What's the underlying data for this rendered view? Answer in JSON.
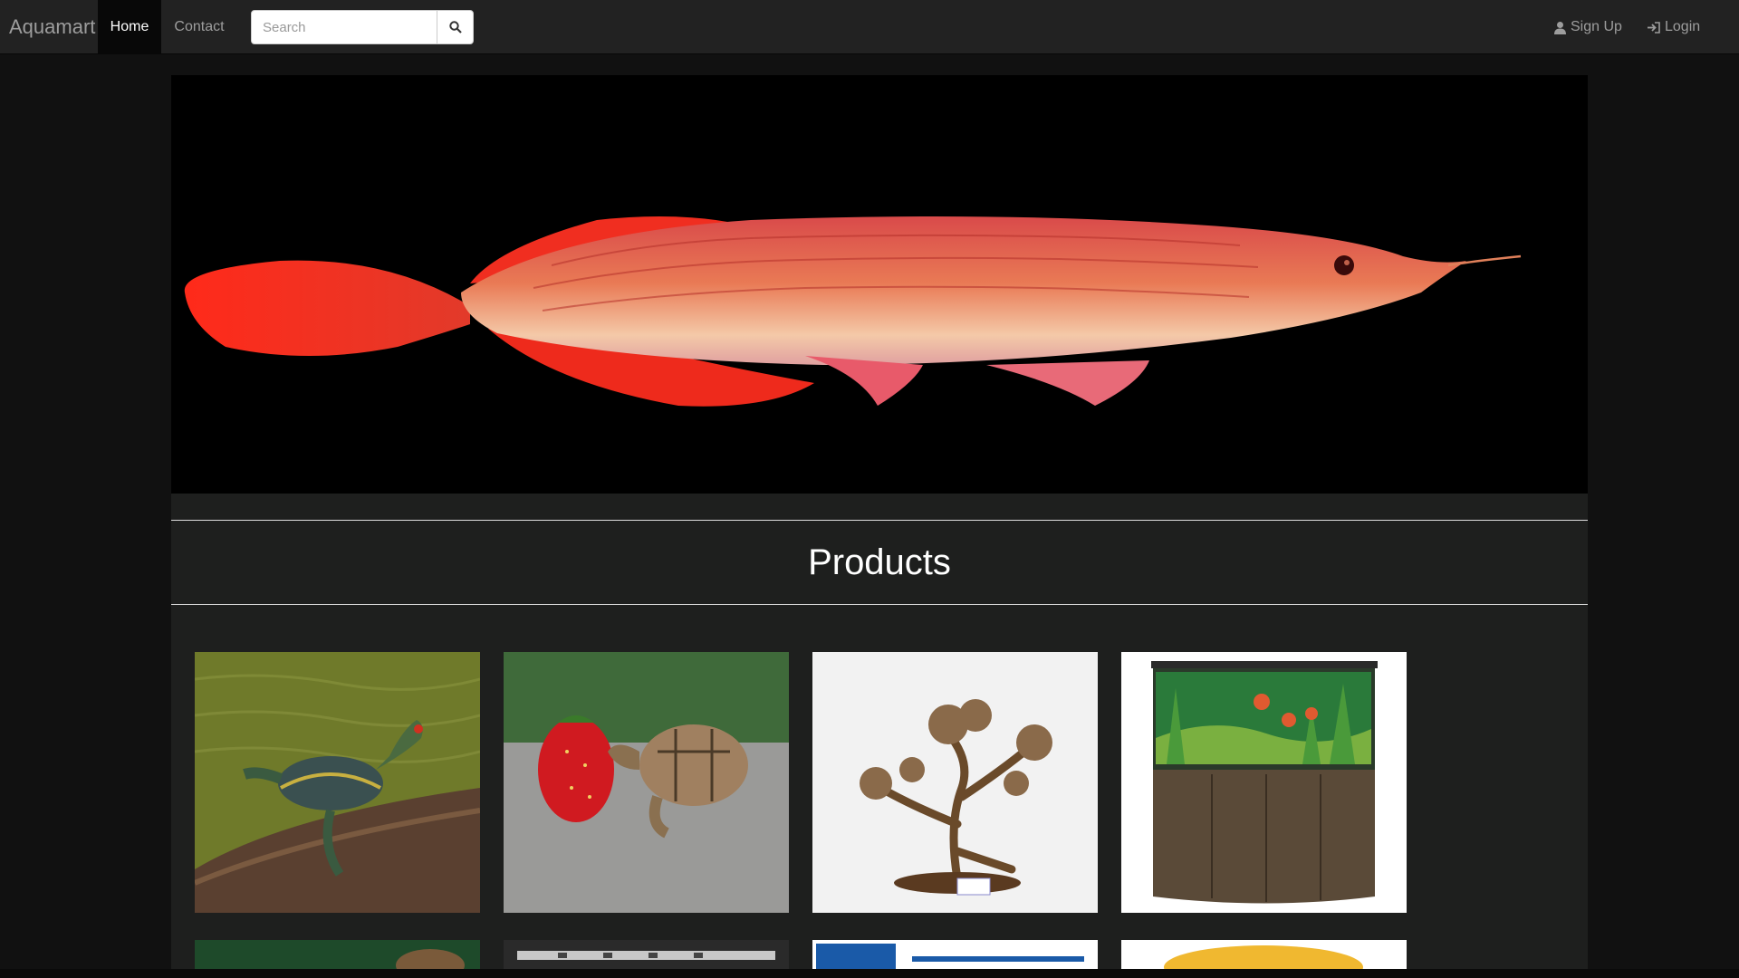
{
  "navbar": {
    "brand": "Aquamart",
    "links": [
      {
        "label": "Home",
        "active": true
      },
      {
        "label": "Contact",
        "active": false
      }
    ],
    "search": {
      "placeholder": "Search",
      "button_icon": "search-icon"
    },
    "right_links": [
      {
        "label": "Sign Up",
        "icon": "user-icon"
      },
      {
        "label": "Login",
        "icon": "login-icon"
      }
    ]
  },
  "hero": {
    "image": "red-arowana-fish"
  },
  "products": {
    "title": "Products",
    "items": [
      {
        "image": "red-eared-slider-turtle"
      },
      {
        "image": "tortoise-with-strawberry"
      },
      {
        "image": "bonsai-driftwood-decoration"
      },
      {
        "image": "curved-aquarium-cabinet"
      },
      {
        "image": "turtle-on-green-background"
      },
      {
        "image": "led-aquarium-light"
      },
      {
        "image": "aquanice-led-lighting"
      },
      {
        "image": "yellow-product"
      }
    ]
  },
  "colors": {
    "navbar": "#222222",
    "page": "#111111",
    "panel": "#1e1f1e",
    "accent_fish": "#e8302a"
  }
}
